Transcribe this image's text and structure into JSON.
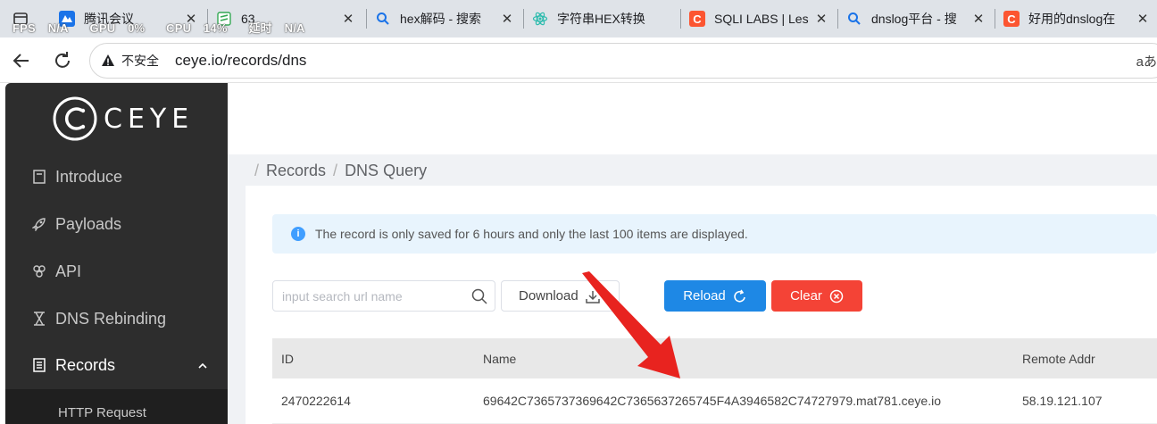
{
  "overlay": {
    "fps": "FPS",
    "fps_val": "N/A",
    "gpu": "GPU",
    "gpu_val": "0%",
    "cpu": "CPU",
    "cpu_val": "14%",
    "latency": "延时",
    "latency_val": "N/A"
  },
  "tabs": [
    {
      "title": "",
      "icon": "window-icon"
    },
    {
      "title": "腾讯会议",
      "icon": "tencent-meeting-icon"
    },
    {
      "title": "63",
      "icon": "notes-icon"
    },
    {
      "title": "hex解码 - 搜索",
      "icon": "search-icon"
    },
    {
      "title": "字符串HEX转换",
      "icon": "react-icon"
    },
    {
      "title": "SQLI LABS | Les",
      "icon": "csdn-icon"
    },
    {
      "title": "dnslog平台 - 搜",
      "icon": "search-icon"
    },
    {
      "title": "好用的dnslog在",
      "icon": "csdn-icon"
    }
  ],
  "address": {
    "insecure": "不安全",
    "url": "ceye.io/records/dns",
    "read_aloud": "aあ"
  },
  "sidebar": {
    "logo": "CEYE",
    "items": [
      {
        "label": "Introduce",
        "icon": "book-icon"
      },
      {
        "label": "Payloads",
        "icon": "rocket-icon"
      },
      {
        "label": "API",
        "icon": "api-icon"
      },
      {
        "label": "DNS Rebinding",
        "icon": "hourglass-icon"
      },
      {
        "label": "Records",
        "icon": "list-icon"
      }
    ],
    "submenu": [
      {
        "label": "HTTP Request"
      }
    ]
  },
  "breadcrumb": {
    "root": "Records",
    "current": "DNS Query",
    "sep": "/"
  },
  "alert": {
    "icon": "i",
    "text": "The record is only saved for 6 hours and only the last 100 items are displayed."
  },
  "toolbar": {
    "search_placeholder": "input search url name",
    "download": "Download",
    "reload": "Reload",
    "clear": "Clear"
  },
  "table": {
    "headers": [
      "ID",
      "Name",
      "Remote Addr"
    ],
    "rows": [
      [
        "2470222614",
        "69642C7365737369642C7365637265745F4A3946582C74727979.mat781.ceye.io",
        "58.19.121.107"
      ]
    ]
  },
  "colors": {
    "primary": "#1e88e5",
    "danger": "#f44336",
    "sidebar": "#2d2d2d",
    "info": "#409eff",
    "annotation": "#e8231f"
  }
}
